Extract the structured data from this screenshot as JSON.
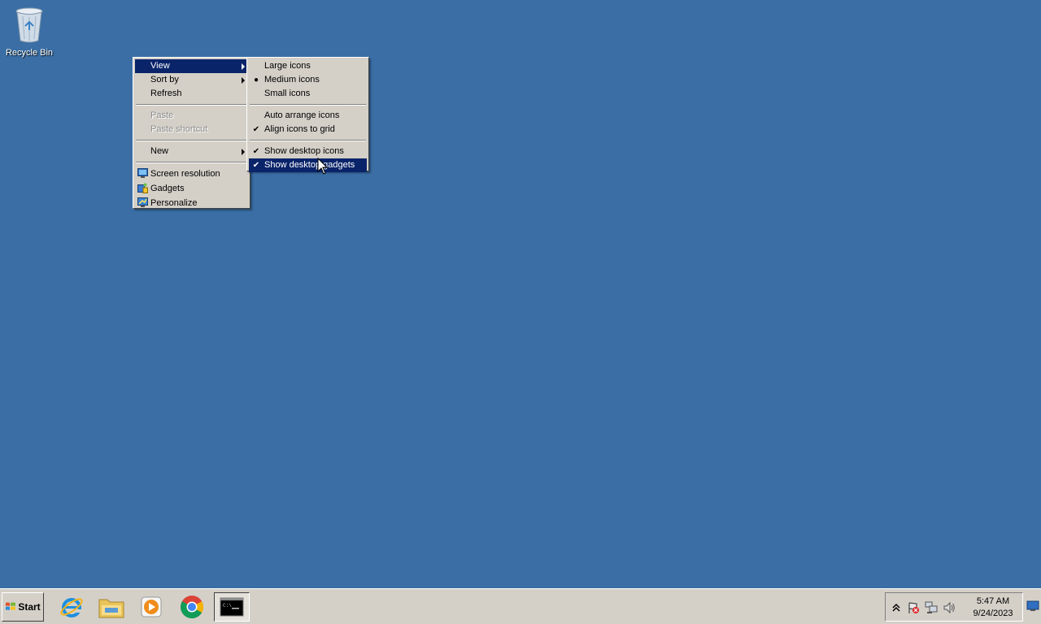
{
  "desktop": {
    "background": "#3a6ea5",
    "icons": [
      {
        "label": "Recycle Bin",
        "icon": "recycle-bin-icon"
      }
    ]
  },
  "context_menu": {
    "items": [
      {
        "label": "View",
        "submenu": true,
        "highlighted": true
      },
      {
        "label": "Sort by",
        "submenu": true
      },
      {
        "label": "Refresh"
      },
      {
        "label": "Paste",
        "disabled": true
      },
      {
        "label": "Paste shortcut",
        "disabled": true
      },
      {
        "label": "New",
        "submenu": true
      },
      {
        "label": "Screen resolution",
        "icon": "screen-resolution-icon"
      },
      {
        "label": "Gadgets",
        "icon": "gadgets-icon"
      },
      {
        "label": "Personalize",
        "icon": "personalize-icon"
      }
    ]
  },
  "view_submenu": {
    "items": [
      {
        "label": "Large icons"
      },
      {
        "label": "Medium icons",
        "mark": "●"
      },
      {
        "label": "Small icons"
      },
      {
        "label": "Auto arrange icons"
      },
      {
        "label": "Align icons to grid",
        "mark": "✔"
      },
      {
        "label": "Show desktop icons",
        "mark": "✔"
      },
      {
        "label": "Show desktop gadgets",
        "mark": "✔",
        "highlighted": true
      }
    ]
  },
  "taskbar": {
    "start_label": "Start",
    "apps": [
      {
        "name": "Internet Explorer",
        "icon": "internet-explorer-icon"
      },
      {
        "name": "Windows Explorer",
        "icon": "folder-icon"
      },
      {
        "name": "Windows Media Player",
        "icon": "media-player-icon"
      },
      {
        "name": "Google Chrome",
        "icon": "chrome-icon"
      },
      {
        "name": "Command Prompt",
        "icon": "command-prompt-icon",
        "active": true
      }
    ],
    "tray_icons": [
      "chevron-up-icon",
      "action-center-flag-icon",
      "network-icon",
      "volume-icon"
    ],
    "clock": {
      "time": "5:47 AM",
      "date": "9/24/2023"
    }
  },
  "colors": {
    "menu_bg": "#d4d0c8",
    "highlight": "#0a246a",
    "disabled_text": "#8c8c8c"
  }
}
